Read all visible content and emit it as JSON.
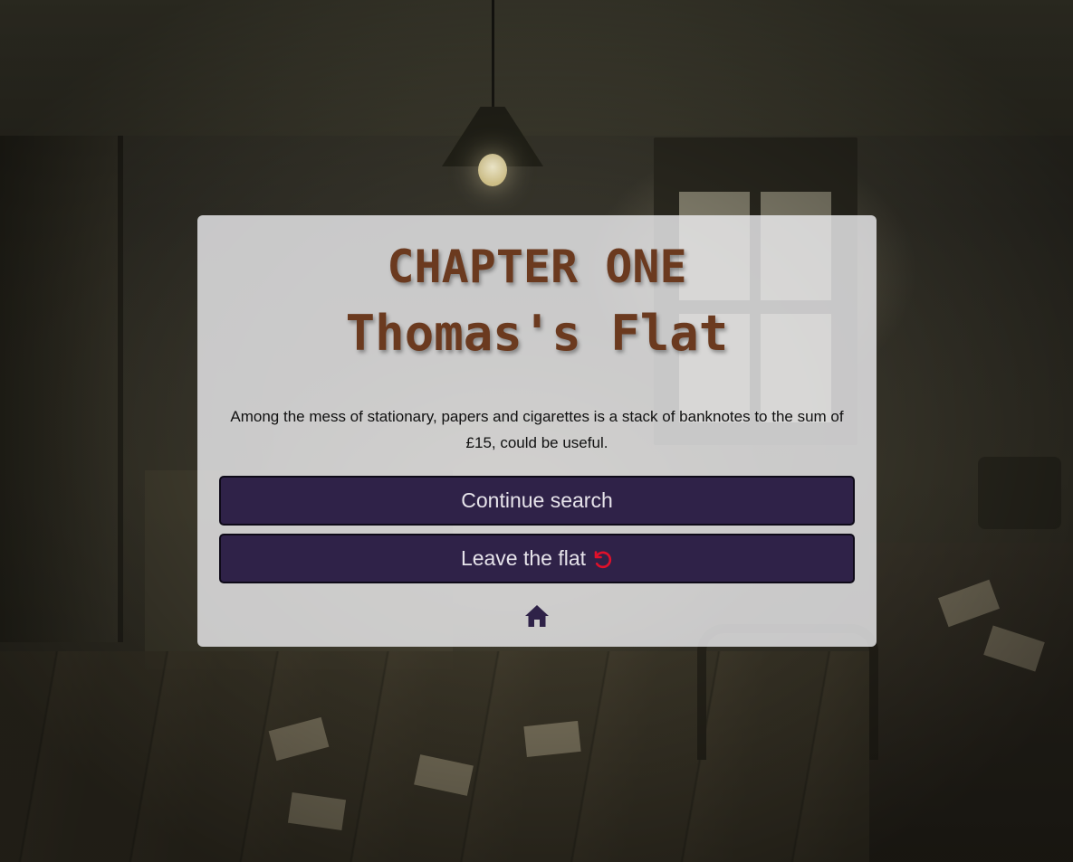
{
  "chapter": {
    "heading": "CHAPTER ONE",
    "location": "Thomas's Flat"
  },
  "story": {
    "text": "Among the mess of stationary, papers and cigarettes is a stack of banknotes to the sum of £15, could be useful."
  },
  "choices": [
    {
      "label": "Continue search",
      "icon": null
    },
    {
      "label": "Leave the flat",
      "icon": "restart-icon"
    }
  ],
  "nav": {
    "home_icon": "home-icon"
  },
  "colors": {
    "title": "#6b3a1f",
    "button_bg": "#2f2248",
    "button_text": "#e6e3ea",
    "restart_icon": "#e0102a",
    "home_icon": "#2f2248",
    "panel_bg": "#ececee"
  }
}
